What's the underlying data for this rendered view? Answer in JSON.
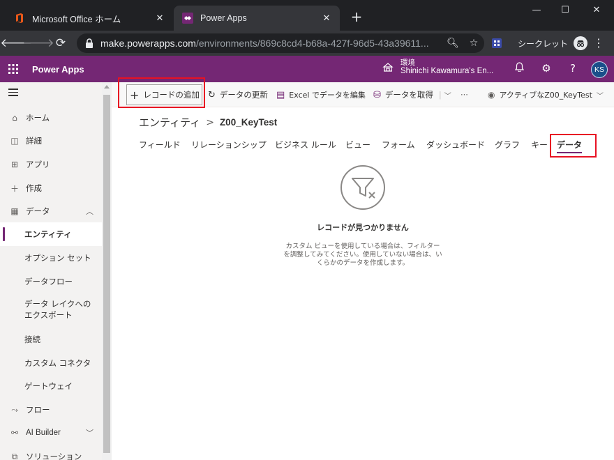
{
  "browser": {
    "tabs": [
      {
        "title": "Microsoft Office ホーム",
        "active": false,
        "icon": "office-icon"
      },
      {
        "title": "Power Apps",
        "active": true,
        "icon": "powerapps-icon"
      }
    ],
    "address": {
      "host": "make.powerapps.com",
      "path": "/environments/869c8cd4-b68a-427f-96d5-43a39611..."
    },
    "incognito_label": "シークレット"
  },
  "header": {
    "app_name": "Power Apps",
    "environment_label": "環境",
    "environment_name": "Shinichi Kawamura's En...",
    "user_initials": "KS",
    "help_label": "?"
  },
  "sidebar": {
    "items": [
      {
        "label": "ホーム",
        "icon": "home-icon"
      },
      {
        "label": "詳細",
        "icon": "book-icon"
      },
      {
        "label": "アプリ",
        "icon": "apps-icon"
      },
      {
        "label": "作成",
        "icon": "plus-icon"
      },
      {
        "label": "データ",
        "icon": "table-icon"
      },
      {
        "label": "エンティティ"
      },
      {
        "label": "オプション セット"
      },
      {
        "label": "データフロー"
      },
      {
        "label": "データ レイクへのエクスポート"
      },
      {
        "label": "接続"
      },
      {
        "label": "カスタム コネクタ"
      },
      {
        "label": "ゲートウェイ"
      },
      {
        "label": "フロー",
        "icon": "flow-icon"
      },
      {
        "label": "AI Builder",
        "icon": "ai-builder-icon"
      },
      {
        "label": "ソリューション",
        "icon": "solutions-icon"
      }
    ],
    "selected": "エンティティ"
  },
  "commands": {
    "add_record": "レコードの追加",
    "refresh": "データの更新",
    "excel": "Excel でデータを編集",
    "get_data": "データを取得",
    "more": "···",
    "view": "アクティブなZ00_KeyTest"
  },
  "breadcrumb": {
    "parent": "エンティティ",
    "separator": ">",
    "current": "Z00_KeyTest"
  },
  "entity_tabs": [
    "フィールド",
    "リレーションシップ",
    "ビジネス ルール",
    "ビュー",
    "フォーム",
    "ダッシュボード",
    "グラフ",
    "キー",
    "データ"
  ],
  "active_tab": "データ",
  "empty_state": {
    "title": "レコードが見つかりません",
    "desc_line1": "カスタム ビューを使用している場合は、フィルター",
    "desc_line2": "を調整してみてください。使用していない場合は、い",
    "desc_line3": "くらかのデータを作成します。"
  },
  "colors": {
    "brand": "#742774",
    "highlight": "#e81123",
    "chrome_dark": "#202124"
  }
}
